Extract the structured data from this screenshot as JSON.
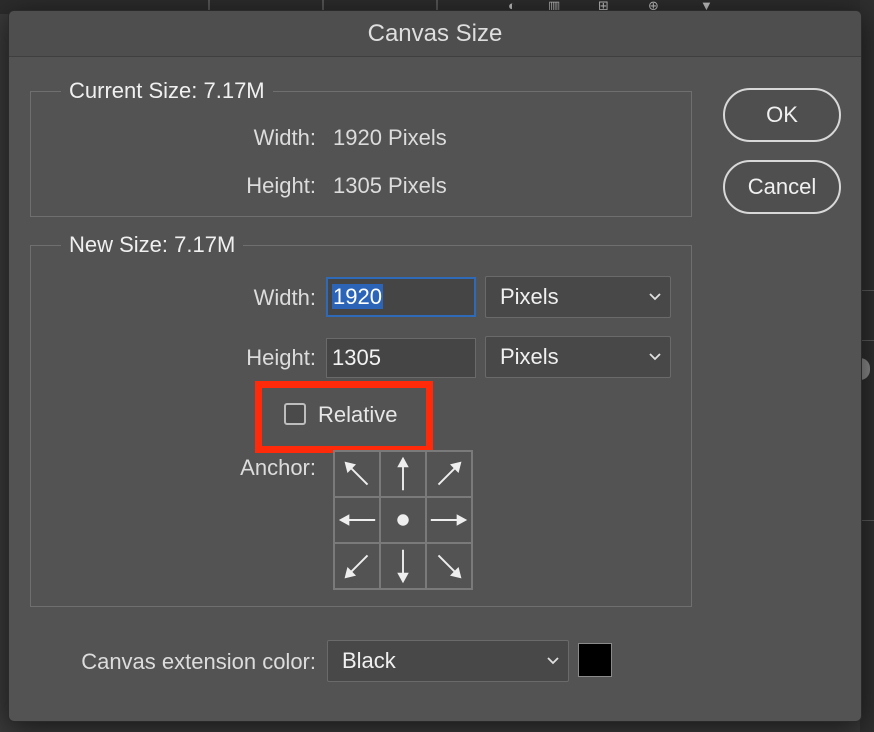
{
  "dialog": {
    "title": "Canvas Size",
    "ok_label": "OK",
    "cancel_label": "Cancel"
  },
  "current_size": {
    "legend": "Current Size: 7.17M",
    "width_label": "Width:",
    "width_value": "1920 Pixels",
    "height_label": "Height:",
    "height_value": "1305 Pixels"
  },
  "new_size": {
    "legend": "New Size: 7.17M",
    "width_label": "Width:",
    "width_value": "1920",
    "width_unit": "Pixels",
    "height_label": "Height:",
    "height_value": "1305",
    "height_unit": "Pixels",
    "relative_label": "Relative",
    "relative_checked": false,
    "anchor_label": "Anchor:",
    "anchor_selected": "center"
  },
  "extension": {
    "label": "Canvas extension color:",
    "value": "Black",
    "swatch_color": "#000000"
  },
  "colors": {
    "highlight": "#ff2a0a",
    "selection": "#2c64b8"
  }
}
